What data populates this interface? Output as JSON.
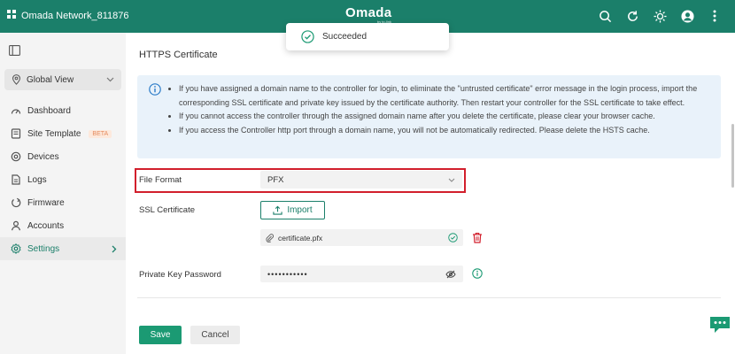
{
  "header": {
    "site_name": "Omada Network_811876",
    "brand": "Omada",
    "brand_sub": "by tp-link",
    "icons": [
      "search-icon",
      "refresh-icon",
      "theme-icon",
      "avatar",
      "more-icon"
    ],
    "colors": {
      "primary": "#1b7f6a",
      "success": "#1b9a73",
      "highlight": "#d21f2c",
      "beta": "#e58a5c"
    }
  },
  "toast": {
    "message": "Succeeded"
  },
  "sidebar": {
    "global_view": "Global View",
    "items": [
      {
        "label": "Dashboard",
        "icon": "dashboard-icon"
      },
      {
        "label": "Site Template",
        "icon": "site-template-icon",
        "badge": "BETA"
      },
      {
        "label": "Devices",
        "icon": "devices-icon"
      },
      {
        "label": "Logs",
        "icon": "logs-icon"
      },
      {
        "label": "Firmware",
        "icon": "firmware-icon"
      },
      {
        "label": "Accounts",
        "icon": "accounts-icon"
      },
      {
        "label": "Settings",
        "icon": "settings-icon",
        "active": true
      }
    ]
  },
  "main": {
    "title": "HTTPS Certificate",
    "info": [
      "If you have assigned a domain name to the controller for login, to eliminate the \"untrusted certificate\" error message in the login process, import the corresponding SSL certificate and private key issued by the certificate authority. Then restart your controller for the SSL certificate to take effect.",
      "If you cannot access the controller through the assigned domain name after you delete the certificate, please clear your browser cache.",
      "If you access the Controller http port through a domain name, you will not be automatically redirected. Please delete the HSTS cache."
    ],
    "file_format": {
      "label": "File Format",
      "value": "PFX"
    },
    "ssl_certificate": {
      "label": "SSL Certificate",
      "import_label": "Import",
      "file_name": "certificate.pfx"
    },
    "private_key": {
      "label": "Private Key Password",
      "value": "•••••••••••"
    },
    "buttons": {
      "save": "Save",
      "cancel": "Cancel"
    }
  }
}
